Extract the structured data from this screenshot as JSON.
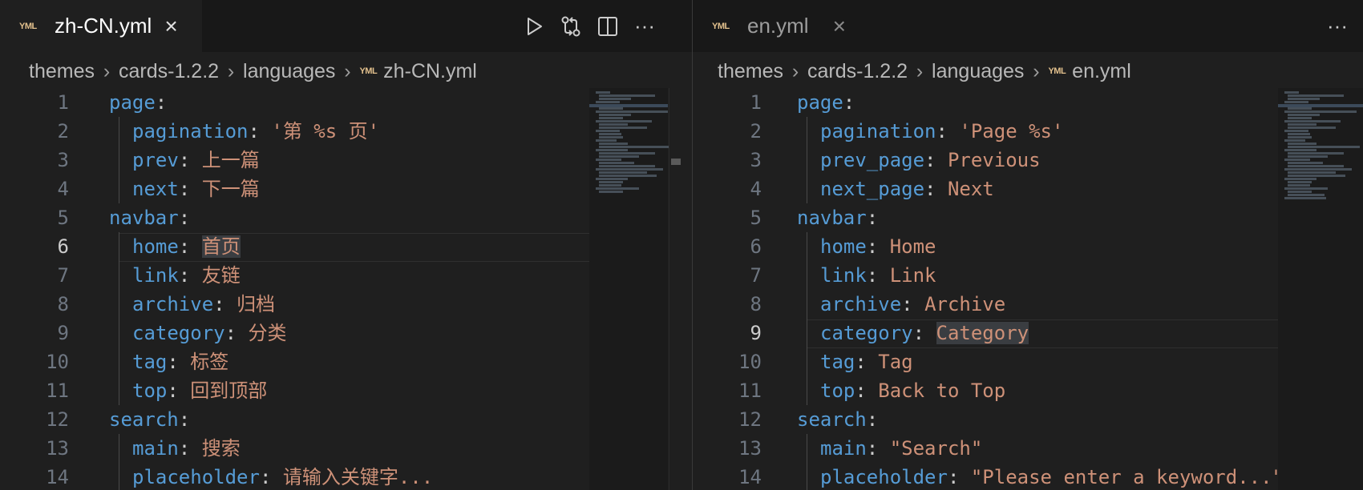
{
  "left": {
    "tab": {
      "badge": "YML",
      "title": "zh-CN.yml",
      "close": "×"
    },
    "breadcrumb": {
      "parts": [
        "themes",
        "cards-1.2.2",
        "languages"
      ],
      "badge": "YML",
      "file": "zh-CN.yml",
      "separator": "›"
    },
    "current_line": 6,
    "lines": [
      {
        "n": "1",
        "indent": 0,
        "key": "page",
        "colon": ":",
        "value": ""
      },
      {
        "n": "2",
        "indent": 1,
        "key": "pagination",
        "colon": ": ",
        "value": "'第 %s 页'"
      },
      {
        "n": "3",
        "indent": 1,
        "key": "prev",
        "colon": ": ",
        "value": "上一篇"
      },
      {
        "n": "4",
        "indent": 1,
        "key": "next",
        "colon": ": ",
        "value": "下一篇"
      },
      {
        "n": "5",
        "indent": 0,
        "key": "navbar",
        "colon": ":",
        "value": ""
      },
      {
        "n": "6",
        "indent": 1,
        "key": "home",
        "colon": ": ",
        "value": "首页"
      },
      {
        "n": "7",
        "indent": 1,
        "key": "link",
        "colon": ": ",
        "value": "友链"
      },
      {
        "n": "8",
        "indent": 1,
        "key": "archive",
        "colon": ": ",
        "value": "归档"
      },
      {
        "n": "9",
        "indent": 1,
        "key": "category",
        "colon": ": ",
        "value": "分类"
      },
      {
        "n": "10",
        "indent": 1,
        "key": "tag",
        "colon": ": ",
        "value": "标签"
      },
      {
        "n": "11",
        "indent": 1,
        "key": "top",
        "colon": ": ",
        "value": "回到顶部"
      },
      {
        "n": "12",
        "indent": 0,
        "key": "search",
        "colon": ":",
        "value": ""
      },
      {
        "n": "13",
        "indent": 1,
        "key": "main",
        "colon": ": ",
        "value": "搜索"
      },
      {
        "n": "14",
        "indent": 1,
        "key": "placeholder",
        "colon": ": ",
        "value": "请输入关键字..."
      }
    ]
  },
  "right": {
    "tab": {
      "badge": "YML",
      "title": "en.yml",
      "close": "×"
    },
    "breadcrumb": {
      "parts": [
        "themes",
        "cards-1.2.2",
        "languages"
      ],
      "badge": "YML",
      "file": "en.yml",
      "separator": "›"
    },
    "current_line": 9,
    "lines": [
      {
        "n": "1",
        "indent": 0,
        "key": "page",
        "colon": ":",
        "value": ""
      },
      {
        "n": "2",
        "indent": 1,
        "key": "pagination",
        "colon": ": ",
        "value": "'Page %s'"
      },
      {
        "n": "3",
        "indent": 1,
        "key": "prev_page",
        "colon": ": ",
        "value": "Previous"
      },
      {
        "n": "4",
        "indent": 1,
        "key": "next_page",
        "colon": ": ",
        "value": "Next"
      },
      {
        "n": "5",
        "indent": 0,
        "key": "navbar",
        "colon": ":",
        "value": ""
      },
      {
        "n": "6",
        "indent": 1,
        "key": "home",
        "colon": ": ",
        "value": "Home"
      },
      {
        "n": "7",
        "indent": 1,
        "key": "link",
        "colon": ": ",
        "value": "Link"
      },
      {
        "n": "8",
        "indent": 1,
        "key": "archive",
        "colon": ": ",
        "value": "Archive"
      },
      {
        "n": "9",
        "indent": 1,
        "key": "category",
        "colon": ": ",
        "value": "Category"
      },
      {
        "n": "10",
        "indent": 1,
        "key": "tag",
        "colon": ": ",
        "value": "Tag"
      },
      {
        "n": "11",
        "indent": 1,
        "key": "top",
        "colon": ": ",
        "value": "Back to Top"
      },
      {
        "n": "12",
        "indent": 0,
        "key": "search",
        "colon": ":",
        "value": ""
      },
      {
        "n": "13",
        "indent": 1,
        "key": "main",
        "colon": ": ",
        "value": "\"Search\""
      },
      {
        "n": "14",
        "indent": 1,
        "key": "placeholder",
        "colon": ": ",
        "value": "\"Please enter a keyword...\""
      }
    ]
  },
  "toolbar": {
    "more": "···"
  },
  "colors": {
    "key": "#569cd6",
    "value": "#ce9178",
    "editor_bg": "#1f1f1f",
    "tab_bar_bg": "#181818",
    "yml_badge": "#e2c08d"
  },
  "icons": [
    "yaml-file-icon",
    "close-icon",
    "run-icon",
    "source-control-compare-icon",
    "split-editor-icon",
    "more-actions-icon",
    "chevron-right-icon"
  ]
}
